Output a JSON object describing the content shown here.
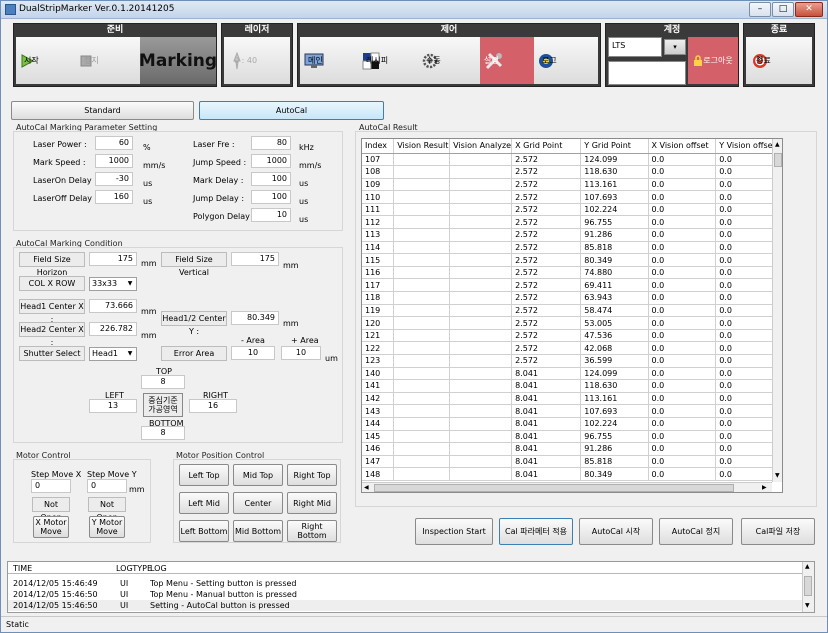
{
  "window": {
    "title": "DualStripMarker Ver.0.1.20141205",
    "min": "–",
    "max": "□",
    "close": "✕"
  },
  "groups": {
    "prepare": "준비",
    "laser": "레이저",
    "control": "제어",
    "account": "계정",
    "exit": "종료"
  },
  "toolbar": {
    "start": "시작",
    "stop": "정지",
    "marking": "Marking",
    "laser_value": "0 : 40",
    "main": "메인",
    "recipe": "레시피",
    "manual": "수동",
    "settings": "설정",
    "log": "로그",
    "account_value": "LTS",
    "logout": "로그아웃",
    "exit": "종료"
  },
  "modes": {
    "standard": "Standard",
    "autocal": "AutoCal"
  },
  "param": {
    "title": "AutoCal Marking Parameter Setting",
    "left": [
      {
        "label": "Laser Power :",
        "value": "60",
        "unit": "%"
      },
      {
        "label": "Mark Speed :",
        "value": "1000",
        "unit": "mm/s"
      },
      {
        "label": "LaserOn Delay :",
        "value": "-30",
        "unit": "us"
      },
      {
        "label": "LaserOff Delay :",
        "value": "160",
        "unit": "us"
      }
    ],
    "right": [
      {
        "label": "Laser Fre :",
        "value": "80",
        "unit": "kHz"
      },
      {
        "label": "Jump Speed :",
        "value": "1000",
        "unit": "mm/s"
      },
      {
        "label": "Mark Delay :",
        "value": "100",
        "unit": "us"
      },
      {
        "label": "Jump Delay :",
        "value": "100",
        "unit": "us"
      },
      {
        "label": "Polygon Delay :",
        "value": "10",
        "unit": "us"
      }
    ]
  },
  "cond": {
    "title": "AutoCal Marking Condition",
    "fsh_label": "Field Size Horizon",
    "fsh_value": "175",
    "fsh_unit": "mm",
    "fsv_label": "Field Size Vertical",
    "fsv_value": "175",
    "fsv_unit": "mm",
    "colrow_label": "COL X ROW",
    "colrow_value": "33x33",
    "h1_label": "Head1 Center X :",
    "h1_value": "73.666",
    "h1_unit": "mm",
    "h12_label": "Head1/2 Center Y :",
    "h12_value": "80.349",
    "h12_unit": "mm",
    "h2_label": "Head2 Center X :",
    "h2_value": "226.782",
    "h2_unit": "mm",
    "shutter_label": "Shutter Select",
    "shutter_value": "Head1",
    "area_minus": "- Area",
    "area_plus": "+ Area",
    "error_label": "Error Area",
    "err_minus": "10",
    "err_plus": "10",
    "err_unit": "um",
    "top_label": "TOP",
    "top_value": "8",
    "left_label": "LEFT",
    "left_value": "13",
    "right_label": "RIGHT",
    "right_value": "16",
    "bottom_label": "BOTTOM",
    "bottom_value": "8",
    "center_label": "중심기준 가공영역"
  },
  "motor": {
    "title": "Motor Control",
    "stepx_label": "Step Move X",
    "stepx_value": "0",
    "stepy_label": "Step Move Y",
    "stepy_value": "0",
    "unit": "mm",
    "x_status": "Not Open",
    "y_status": "Not Open",
    "x_move": "X Motor Move",
    "y_move": "Y Motor Move"
  },
  "motorpos": {
    "title": "Motor Position Control",
    "buttons": [
      "Left Top",
      "Mid Top",
      "Right Top",
      "Left Mid",
      "Center",
      "Right Mid",
      "Left Bottom",
      "Mid Bottom",
      "Right Bottom"
    ]
  },
  "result": {
    "title": "AutoCal Result",
    "columns": [
      "Index",
      "Vision Result",
      "Vision Analyze",
      "X Grid Point",
      "Y Grid Point",
      "X Vision offset",
      "Y Vision offset"
    ],
    "rows": [
      [
        "107",
        "",
        "",
        "2.572",
        "124.099",
        "0.0",
        "0.0"
      ],
      [
        "108",
        "",
        "",
        "2.572",
        "118.630",
        "0.0",
        "0.0"
      ],
      [
        "109",
        "",
        "",
        "2.572",
        "113.161",
        "0.0",
        "0.0"
      ],
      [
        "110",
        "",
        "",
        "2.572",
        "107.693",
        "0.0",
        "0.0"
      ],
      [
        "111",
        "",
        "",
        "2.572",
        "102.224",
        "0.0",
        "0.0"
      ],
      [
        "112",
        "",
        "",
        "2.572",
        "96.755",
        "0.0",
        "0.0"
      ],
      [
        "113",
        "",
        "",
        "2.572",
        "91.286",
        "0.0",
        "0.0"
      ],
      [
        "114",
        "",
        "",
        "2.572",
        "85.818",
        "0.0",
        "0.0"
      ],
      [
        "115",
        "",
        "",
        "2.572",
        "80.349",
        "0.0",
        "0.0"
      ],
      [
        "116",
        "",
        "",
        "2.572",
        "74.880",
        "0.0",
        "0.0"
      ],
      [
        "117",
        "",
        "",
        "2.572",
        "69.411",
        "0.0",
        "0.0"
      ],
      [
        "118",
        "",
        "",
        "2.572",
        "63.943",
        "0.0",
        "0.0"
      ],
      [
        "119",
        "",
        "",
        "2.572",
        "58.474",
        "0.0",
        "0.0"
      ],
      [
        "120",
        "",
        "",
        "2.572",
        "53.005",
        "0.0",
        "0.0"
      ],
      [
        "121",
        "",
        "",
        "2.572",
        "47.536",
        "0.0",
        "0.0"
      ],
      [
        "122",
        "",
        "",
        "2.572",
        "42.068",
        "0.0",
        "0.0"
      ],
      [
        "123",
        "",
        "",
        "2.572",
        "36.599",
        "0.0",
        "0.0"
      ],
      [
        "140",
        "",
        "",
        "8.041",
        "124.099",
        "0.0",
        "0.0"
      ],
      [
        "141",
        "",
        "",
        "8.041",
        "118.630",
        "0.0",
        "0.0"
      ],
      [
        "142",
        "",
        "",
        "8.041",
        "113.161",
        "0.0",
        "0.0"
      ],
      [
        "143",
        "",
        "",
        "8.041",
        "107.693",
        "0.0",
        "0.0"
      ],
      [
        "144",
        "",
        "",
        "8.041",
        "102.224",
        "0.0",
        "0.0"
      ],
      [
        "145",
        "",
        "",
        "8.041",
        "96.755",
        "0.0",
        "0.0"
      ],
      [
        "146",
        "",
        "",
        "8.041",
        "91.286",
        "0.0",
        "0.0"
      ],
      [
        "147",
        "",
        "",
        "8.041",
        "85.818",
        "0.0",
        "0.0"
      ],
      [
        "148",
        "",
        "",
        "8.041",
        "80.349",
        "0.0",
        "0.0"
      ]
    ]
  },
  "actions": [
    "Inspection Start",
    "Cal 파라메터 적용",
    "AutoCal 시작",
    "AutoCal 정지",
    "Cal파일 저장"
  ],
  "log": {
    "columns": [
      "TIME",
      "LOGTYPE",
      "LOG"
    ],
    "rows": [
      [
        "2014/12/05 15:46:49",
        "UI",
        "Top Menu - Setting button is pressed"
      ],
      [
        "2014/12/05 15:46:50",
        "UI",
        "Top Menu - Manual button is pressed"
      ],
      [
        "2014/12/05 15:46:50",
        "UI",
        "Setting - AutoCal button is pressed"
      ]
    ]
  },
  "status": "Static"
}
